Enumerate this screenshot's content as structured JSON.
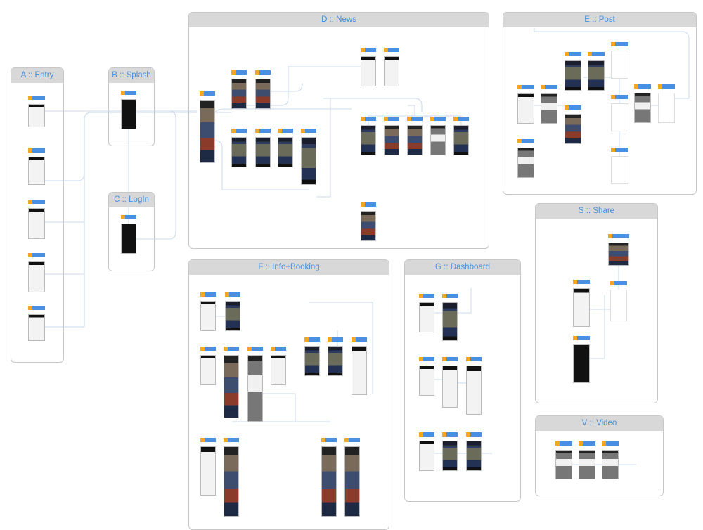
{
  "panels": {
    "a": {
      "title": "A :: Entry"
    },
    "b": {
      "title": "B :: Splash"
    },
    "c": {
      "title": "C :: LogIn"
    },
    "d": {
      "title": "D :: News"
    },
    "e": {
      "title": "E :: Post"
    },
    "f": {
      "title": "F :: Info+Booking"
    },
    "g": {
      "title": "G :: Dashboard"
    },
    "s": {
      "title": "S :: Share"
    },
    "v": {
      "title": "V :: Video"
    }
  },
  "colors": {
    "header_bg": "#d8d8d8",
    "title": "#4a8fd9",
    "label_bar": "#4a90e2",
    "label_tag": "#f5a623",
    "connector": "#c9d9ee"
  }
}
